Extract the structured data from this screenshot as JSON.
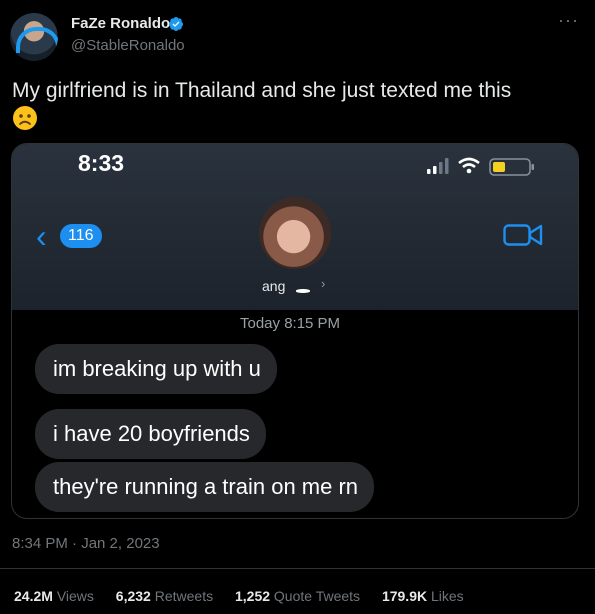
{
  "author": {
    "name": "FaZe Ronaldo",
    "handle": "@StableRonaldo",
    "verified": true
  },
  "more_icon": "more-icon",
  "tweet": {
    "text": "My girlfriend is in Thailand and she just texted me this",
    "emoji": "slightly-frowning-face"
  },
  "screenshot": {
    "status_time": "8:33",
    "back_count": "116",
    "contact_name": "ang",
    "timestamp": "Today 8:15 PM",
    "messages": [
      "im breaking up with u",
      "i have 20 boyfriends",
      "they're running a train on me rn"
    ]
  },
  "meta": {
    "date": "8:34 PM · Jan 2, 2023"
  },
  "stats": {
    "views_value": "24.2M",
    "views_label": "Views",
    "retweets_value": "6,232",
    "retweets_label": "Retweets",
    "quotes_value": "1,252",
    "quotes_label": "Quote Tweets",
    "likes_value": "179.9K",
    "likes_label": "Likes"
  },
  "colors": {
    "accent": "#1d9bf0",
    "bubble": "#26282b",
    "muted": "#71767b"
  }
}
